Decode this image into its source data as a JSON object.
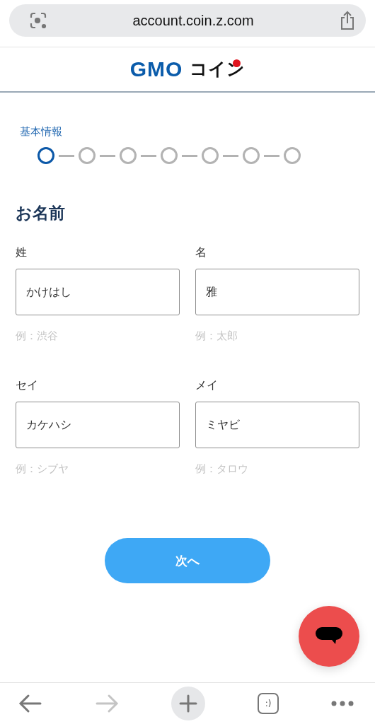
{
  "browser": {
    "url": "account.coin.z.com"
  },
  "logo": {
    "brand": "GMO",
    "suffix": "コイン"
  },
  "progress": {
    "label": "基本情報",
    "steps": [
      {
        "selected": true
      },
      {
        "selected": false
      },
      {
        "selected": false
      },
      {
        "selected": false
      },
      {
        "selected": false
      },
      {
        "selected": false
      },
      {
        "selected": false
      }
    ]
  },
  "section_title": "お名前",
  "fields": [
    {
      "label": "姓",
      "value": "かけはし",
      "hint": "例：渋谷"
    },
    {
      "label": "名",
      "value": "雅",
      "hint": "例：太郎"
    },
    {
      "label": "セイ",
      "value": "カケハシ",
      "hint": "例：シブヤ"
    },
    {
      "label": "メイ",
      "value": "ミヤビ",
      "hint": "例：タロウ"
    }
  ],
  "next_button": "次へ",
  "toolbar": {
    "back_disabled": false,
    "forward_disabled": true,
    "tabs_label": ":)"
  }
}
